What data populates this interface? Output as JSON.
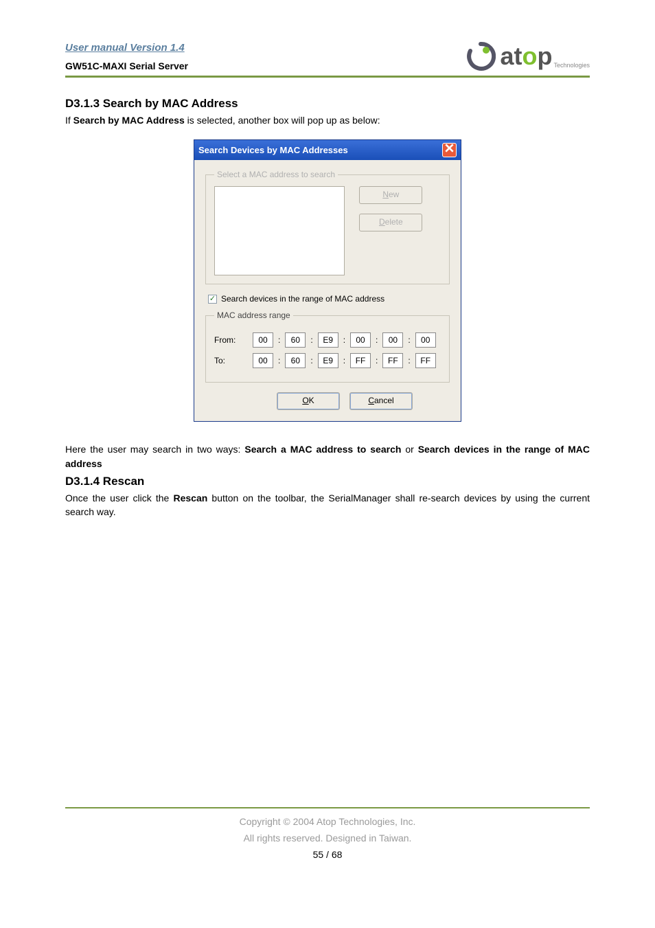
{
  "header": {
    "manual_version": "User manual Version 1.4",
    "product": "GW51C-MAXI Serial Server",
    "logo_main": "at",
    "logo_green": "o",
    "logo_end": "p",
    "logo_sub": "Technologies"
  },
  "section1": {
    "title": "D3.1.3 Search by MAC Address",
    "line_pre": "If ",
    "line_bold": "Search by MAC Address",
    "line_post": " is selected, another box will pop up as below:"
  },
  "dialog": {
    "title": "Search Devices by MAC Addresses",
    "close": "X",
    "group1_legend": "Select a MAC address to search",
    "btn_new": "New",
    "btn_delete": "Delete",
    "checkbox_label": "Search devices in the range of MAC address",
    "checkbox_mark": "✓",
    "group2_legend": "MAC address range",
    "label_from": "From:",
    "label_to": "To:",
    "from": [
      "00",
      "60",
      "E9",
      "00",
      "00",
      "00"
    ],
    "to": [
      "00",
      "60",
      "E9",
      "FF",
      "FF",
      "FF"
    ],
    "ok": "OK",
    "cancel": "Cancel"
  },
  "para2_pre": "Here the user may search in two ways: ",
  "para2_b1": "Search a MAC address to search",
  "para2_mid": " or ",
  "para2_b2": "Search devices in the range of MAC address",
  "section2": {
    "title": "D3.1.4 Rescan",
    "line_pre": "Once the user click the ",
    "line_bold": "Rescan",
    "line_post": " button on the toolbar, the SerialManager shall re-search devices by using the current search way."
  },
  "footer": {
    "copyright": "Copyright © 2004 Atop Technologies, Inc.",
    "rights": "All rights reserved. Designed in Taiwan.",
    "page": "55 / 68"
  }
}
